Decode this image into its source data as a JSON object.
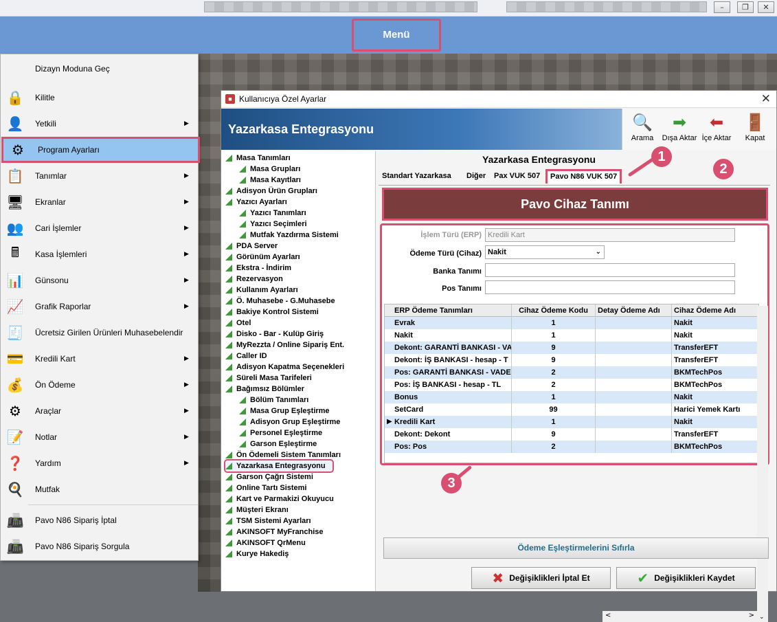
{
  "menu_bar": {
    "menu_label": "Menü"
  },
  "dropdown": {
    "items": [
      {
        "label": "Dizayn Moduna Geç",
        "icon": "",
        "arrow": false
      },
      {
        "label": "Kilitle",
        "icon": "lock-icon",
        "arrow": false
      },
      {
        "label": "Yetkili",
        "icon": "user-icon",
        "arrow": true
      },
      {
        "label": "Program Ayarları",
        "icon": "settings-icon",
        "arrow": false
      },
      {
        "label": "Tanımlar",
        "icon": "definitions-icon",
        "arrow": true
      },
      {
        "label": "Ekranlar",
        "icon": "screens-icon",
        "arrow": true
      },
      {
        "label": "Cari İşlemler",
        "icon": "accounts-icon",
        "arrow": true
      },
      {
        "label": "Kasa İşlemleri",
        "icon": "cash-register-icon",
        "arrow": true
      },
      {
        "label": "Günsonu",
        "icon": "day-end-icon",
        "arrow": true
      },
      {
        "label": "Grafik Raporlar",
        "icon": "chart-icon",
        "arrow": true
      },
      {
        "label": "Ücretsiz Girilen Ürünleri Muhasebelendir",
        "icon": "free-products-icon",
        "arrow": false
      },
      {
        "label": "Kredili Kart",
        "icon": "credit-card-icon",
        "arrow": true
      },
      {
        "label": "Ön Ödeme",
        "icon": "prepayment-icon",
        "arrow": true
      },
      {
        "label": "Araçlar",
        "icon": "tools-icon",
        "arrow": true
      },
      {
        "label": "Notlar",
        "icon": "notes-icon",
        "arrow": true
      },
      {
        "label": "Yardım",
        "icon": "help-icon",
        "arrow": true
      },
      {
        "label": "Mutfak",
        "icon": "kitchen-icon",
        "arrow": false
      },
      {
        "label": "Pavo N86 Sipariş İptal",
        "icon": "pos-cancel-icon",
        "arrow": false
      },
      {
        "label": "Pavo N86 Sipariş Sorgula",
        "icon": "pos-query-icon",
        "arrow": false
      }
    ],
    "active_index": 3
  },
  "dialog": {
    "title": "Kullanıcıya Özel Ayarlar",
    "banner": "Yazarkasa Entegrasyonu",
    "toolbar": {
      "search": "Arama",
      "export": "Dışa Aktar",
      "import": "İçe Aktar",
      "close": "Kapat"
    }
  },
  "tree": [
    {
      "label": "Masa Tanımları",
      "level": 0
    },
    {
      "label": "Masa Grupları",
      "level": 1
    },
    {
      "label": "Masa Kayıtları",
      "level": 1
    },
    {
      "label": "Adisyon Ürün Grupları",
      "level": 0
    },
    {
      "label": "Yazıcı Ayarları",
      "level": 0
    },
    {
      "label": "Yazıcı Tanımları",
      "level": 1
    },
    {
      "label": "Yazıcı Seçimleri",
      "level": 1
    },
    {
      "label": "Mutfak Yazdırma Sistemi",
      "level": 1
    },
    {
      "label": "PDA Server",
      "level": 0
    },
    {
      "label": "Görünüm Ayarları",
      "level": 0
    },
    {
      "label": "Ekstra - İndirim",
      "level": 0
    },
    {
      "label": "Rezervasyon",
      "level": 0
    },
    {
      "label": "Kullanım Ayarları",
      "level": 0
    },
    {
      "label": "Ö. Muhasebe - G.Muhasebe",
      "level": 0
    },
    {
      "label": "Bakiye Kontrol Sistemi",
      "level": 0
    },
    {
      "label": "Otel",
      "level": 0
    },
    {
      "label": "Disko - Bar - Kulüp Giriş",
      "level": 0
    },
    {
      "label": "MyRezzta / Online Sipariş Ent.",
      "level": 0
    },
    {
      "label": "Caller ID",
      "level": 0
    },
    {
      "label": "Adisyon Kapatma Seçenekleri",
      "level": 0
    },
    {
      "label": "Süreli Masa Tarifeleri",
      "level": 0
    },
    {
      "label": "Bağımsız Bölümler",
      "level": 0
    },
    {
      "label": "Bölüm Tanımları",
      "level": 1
    },
    {
      "label": "Masa Grup Eşleştirme",
      "level": 1
    },
    {
      "label": "Adisyon Grup Eşleştirme",
      "level": 1
    },
    {
      "label": "Personel Eşleştirme",
      "level": 1
    },
    {
      "label": "Garson Eşleştirme",
      "level": 1
    },
    {
      "label": "Ön Ödemeli Sistem Tanımları",
      "level": 0
    },
    {
      "label": "Yazarkasa Entegrasyonu",
      "level": 0,
      "selected": true
    },
    {
      "label": "Garson Çağrı Sistemi",
      "level": 0
    },
    {
      "label": "Online Tartı Sistemi",
      "level": 0
    },
    {
      "label": "Kart ve Parmakizi Okuyucu",
      "level": 0
    },
    {
      "label": "Müşteri Ekranı",
      "level": 0
    },
    {
      "label": "TSM Sistemi Ayarları",
      "level": 0
    },
    {
      "label": "AKINSOFT MyFranchise",
      "level": 0
    },
    {
      "label": "AKINSOFT QrMenu",
      "level": 0
    },
    {
      "label": "Kurye Hakediş",
      "level": 0
    }
  ],
  "panel": {
    "title": "Yazarkasa Entegrasyonu",
    "tabs": [
      "Standart Yazarkasa",
      "Diğer",
      "Pax VUK 507",
      "Pavo N86 VUK 507"
    ],
    "active_tab": 3,
    "header": "Pavo Cihaz Tanımı",
    "form": {
      "islem_turu_label": "İşlem Türü (ERP)",
      "islem_turu_value": "Kredili Kart",
      "odeme_turu_label": "Ödeme Türü (Cihaz)",
      "odeme_turu_value": "Nakit",
      "banka_label": "Banka Tanımı",
      "banka_value": "",
      "pos_label": "Pos Tanımı",
      "pos_value": ""
    },
    "grid": {
      "columns": [
        "ERP Ödeme Tanımları",
        "Cihaz Ödeme Kodu",
        "Detay Ödeme Adı",
        "Cihaz Ödeme Adı"
      ],
      "rows": [
        [
          "Evrak",
          "1",
          "",
          "Nakit"
        ],
        [
          "Nakit",
          "1",
          "",
          "Nakit"
        ],
        [
          "Dekont: GARANTİ BANKASI - VA",
          "9",
          "",
          "TransferEFT"
        ],
        [
          "Dekont: İŞ BANKASI - hesap - T",
          "9",
          "",
          "TransferEFT"
        ],
        [
          "Pos: GARANTİ BANKASI - VADES",
          "2",
          "",
          "BKMTechPos"
        ],
        [
          "Pos: İŞ BANKASI - hesap - TL",
          "2",
          "",
          "BKMTechPos"
        ],
        [
          "Bonus",
          "1",
          "",
          "Nakit"
        ],
        [
          "SetCard",
          "99",
          "",
          "Harici Yemek Kartı"
        ],
        [
          "Kredili Kart",
          "1",
          "",
          "Nakit"
        ],
        [
          "Dekont: Dekont",
          "9",
          "",
          "TransferEFT"
        ],
        [
          "Pos: Pos",
          "2",
          "",
          "BKMTechPos"
        ]
      ],
      "current_row": 8
    },
    "reset_button": "Ödeme Eşleştirmelerini Sıfırla",
    "cancel_button": "Değişiklikleri İptal Et",
    "save_button": "Değişiklikleri Kaydet"
  },
  "callouts": [
    "1",
    "2",
    "3"
  ],
  "colors": {
    "highlight": "#d94f70",
    "menubar": "#6b97d3",
    "header": "#7a3c3c",
    "alt_row": "#d9e8f8"
  }
}
